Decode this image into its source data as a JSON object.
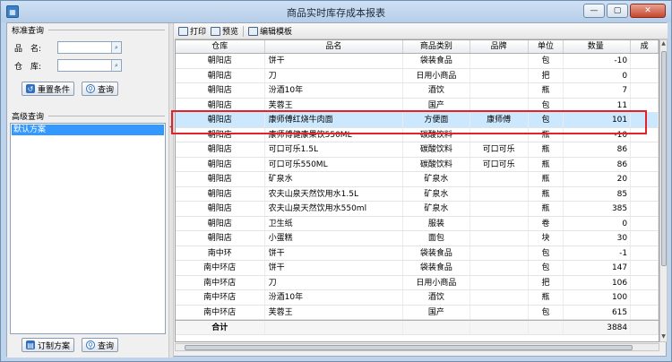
{
  "window": {
    "title": "商品实时库存成本报表",
    "icon": "app-icon",
    "controls": [
      "minimize-icon",
      "maximize-icon",
      "close-icon"
    ]
  },
  "left_panel": {
    "standard_query_label": "标准查询",
    "product_label": "品　名:",
    "product_value": "",
    "warehouse_label": "仓　库:",
    "warehouse_value": "",
    "reset_button": "重置条件",
    "query_button": "查询",
    "advanced_query_label": "高级查询",
    "schemes": [
      "默认方案"
    ],
    "custom_scheme_button": "订制方案",
    "query_button_2": "查询"
  },
  "toolbar": {
    "print": "打印",
    "preview": "预览",
    "edit_template": "编辑模板"
  },
  "grid": {
    "columns": [
      "仓库",
      "品名",
      "商品类别",
      "品牌",
      "单位",
      "数量",
      "成"
    ],
    "rows": [
      [
        "朝阳店",
        "饼干",
        "袋装食品",
        "",
        "包",
        "-10"
      ],
      [
        "朝阳店",
        "刀",
        "日用小商品",
        "",
        "把",
        "0"
      ],
      [
        "朝阳店",
        "汾酒10年",
        "酒饮",
        "",
        "瓶",
        "7"
      ],
      [
        "朝阳店",
        "芙蓉王",
        "国产",
        "",
        "包",
        "11"
      ],
      [
        "朝阳店",
        "康师傅红烧牛肉面",
        "方便面",
        "康师傅",
        "包",
        "101"
      ],
      [
        "朝阳店",
        "康师傅健康果饮550ML",
        "碳酸饮料",
        "",
        "瓶",
        "-10"
      ],
      [
        "朝阳店",
        "可口可乐1.5L",
        "碳酸饮料",
        "可口可乐",
        "瓶",
        "86"
      ],
      [
        "朝阳店",
        "可口可乐550ML",
        "碳酸饮料",
        "可口可乐",
        "瓶",
        "86"
      ],
      [
        "朝阳店",
        "矿泉水",
        "矿泉水",
        "",
        "瓶",
        "20"
      ],
      [
        "朝阳店",
        "农夫山泉天然饮用水1.5L",
        "矿泉水",
        "",
        "瓶",
        "85"
      ],
      [
        "朝阳店",
        "农夫山泉天然饮用水550ml",
        "矿泉水",
        "",
        "瓶",
        "385"
      ],
      [
        "朝阳店",
        "卫生纸",
        "服装",
        "",
        "卷",
        "0"
      ],
      [
        "朝阳店",
        "小蛋糕",
        "面包",
        "",
        "块",
        "30"
      ],
      [
        "南中环",
        "饼干",
        "袋装食品",
        "",
        "包",
        "-1"
      ],
      [
        "南中环店",
        "饼干",
        "袋装食品",
        "",
        "包",
        "147"
      ],
      [
        "南中环店",
        "刀",
        "日用小商品",
        "",
        "把",
        "106"
      ],
      [
        "南中环店",
        "汾酒10年",
        "酒饮",
        "",
        "瓶",
        "100"
      ],
      [
        "南中环店",
        "芙蓉王",
        "国产",
        "",
        "包",
        "615"
      ]
    ],
    "selected_row": 4,
    "total_label": "合计",
    "total_qty": "3884"
  }
}
